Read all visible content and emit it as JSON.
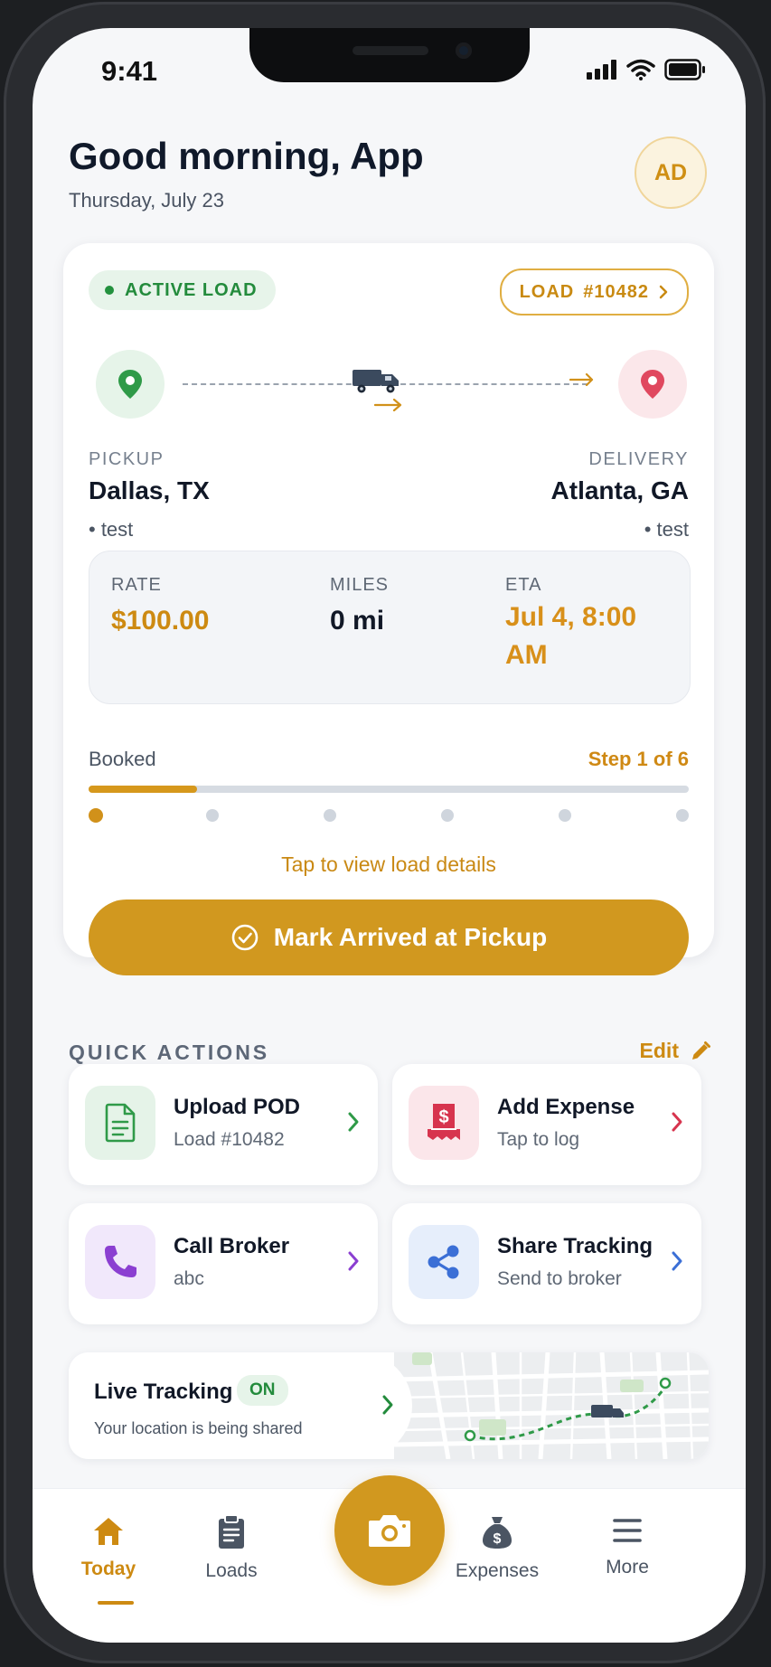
{
  "status": {
    "time": "9:41"
  },
  "header": {
    "greeting": "Good morning, App",
    "date": "Thursday, July 23",
    "avatar": "AD"
  },
  "load": {
    "status_label": "ACTIVE LOAD",
    "load_id_label": "LOAD",
    "load_number": "#10482",
    "pickup": {
      "label": "PICKUP",
      "city": "Dallas, TX",
      "note": "• test"
    },
    "delivery": {
      "label": "DELIVERY",
      "city": "Atlanta, GA",
      "note": "• test"
    },
    "rate": {
      "label": "RATE",
      "value": "$100.00"
    },
    "miles": {
      "label": "MILES",
      "value": "0 mi"
    },
    "eta": {
      "label": "ETA",
      "value_line1": "Jul 4, 8:00",
      "value_line2": "AM"
    },
    "progress": {
      "stage": "Booked",
      "step_text": "Step 1 of 6",
      "current_step": 1,
      "total_steps": 6,
      "fraction": 0.18
    },
    "tap_hint": "Tap to view load details",
    "primary_action": "Mark Arrived at Pickup"
  },
  "quick_actions": {
    "title": "QUICK ACTIONS",
    "edit_label": "Edit",
    "items": [
      {
        "title": "Upload POD",
        "subtitle": "Load #10482",
        "icon": "document-icon",
        "color": "#2f9a48"
      },
      {
        "title": "Add Expense",
        "subtitle": "Tap to log",
        "icon": "receipt-dollar-icon",
        "color": "#d7344e"
      },
      {
        "title": "Call Broker",
        "subtitle": "abc",
        "icon": "phone-icon",
        "color": "#8b3fd1"
      },
      {
        "title": "Share Tracking",
        "subtitle": "Send to broker",
        "icon": "share-icon",
        "color": "#3b6fd6"
      }
    ]
  },
  "live_tracking": {
    "title": "Live Tracking",
    "state": "ON",
    "subtitle": "Your location is being shared"
  },
  "nav": {
    "items": [
      {
        "label": "Today",
        "icon": "home-icon",
        "active": true
      },
      {
        "label": "Loads",
        "icon": "clipboard-icon",
        "active": false
      },
      {
        "label": "Expenses",
        "icon": "money-bag-icon",
        "active": false
      },
      {
        "label": "More",
        "icon": "menu-icon",
        "active": false
      }
    ],
    "center_icon": "camera-icon"
  },
  "colors": {
    "accent": "#d1981f",
    "green": "#238b3c",
    "red": "#d7344e"
  }
}
